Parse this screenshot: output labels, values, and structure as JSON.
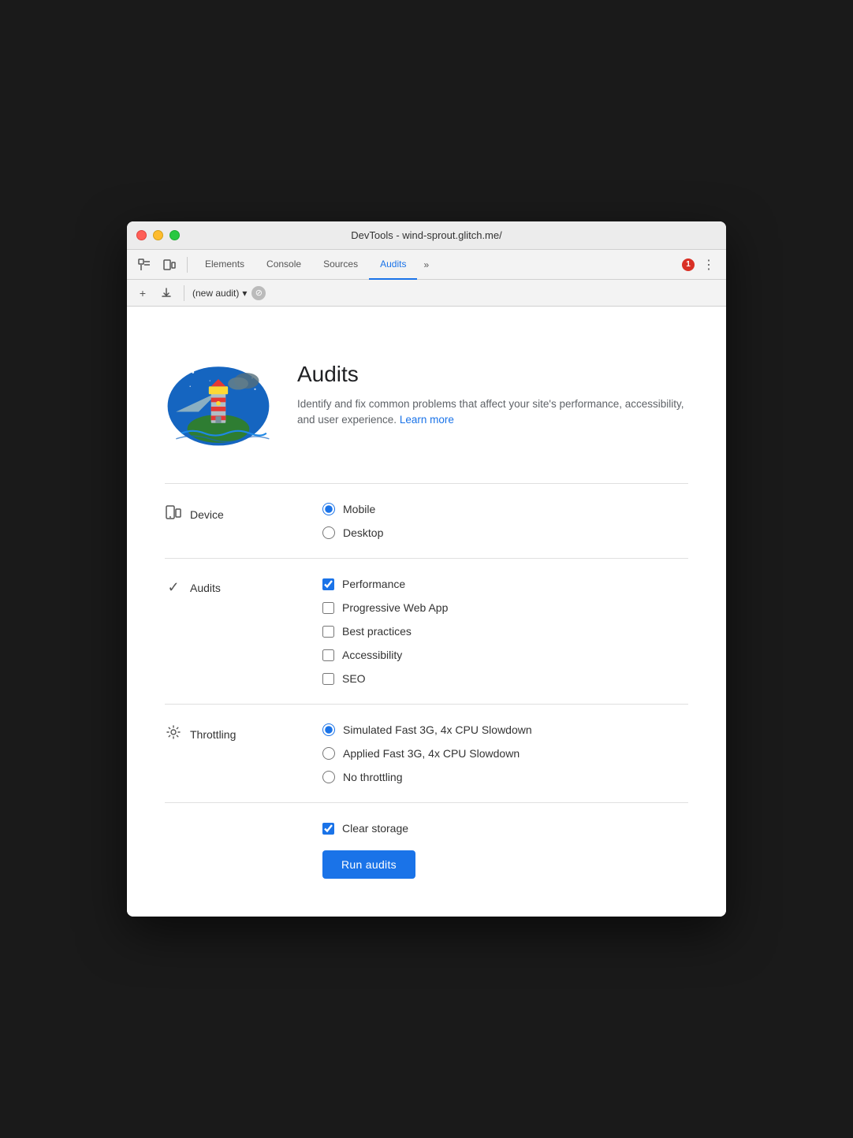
{
  "window": {
    "title": "DevTools - wind-sprout.glitch.me/"
  },
  "tabs": {
    "items": [
      {
        "label": "Elements",
        "active": false
      },
      {
        "label": "Console",
        "active": false
      },
      {
        "label": "Sources",
        "active": false
      },
      {
        "label": "Audits",
        "active": true
      }
    ],
    "overflow_label": "»",
    "error_count": "1"
  },
  "secondary_toolbar": {
    "new_label": "+",
    "download_label": "⬇",
    "audit_name": "(new audit)",
    "dropdown_icon": "▾",
    "cancel_icon": "⊘"
  },
  "hero": {
    "title": "Audits",
    "description": "Identify and fix common problems that affect your site's performance, accessibility, and user experience.",
    "learn_more": "Learn more"
  },
  "device": {
    "label": "Device",
    "options": [
      {
        "label": "Mobile",
        "checked": true
      },
      {
        "label": "Desktop",
        "checked": false
      }
    ]
  },
  "audits": {
    "label": "Audits",
    "options": [
      {
        "label": "Performance",
        "checked": true
      },
      {
        "label": "Progressive Web App",
        "checked": false
      },
      {
        "label": "Best practices",
        "checked": false
      },
      {
        "label": "Accessibility",
        "checked": false
      },
      {
        "label": "SEO",
        "checked": false
      }
    ]
  },
  "throttling": {
    "label": "Throttling",
    "options": [
      {
        "label": "Simulated Fast 3G, 4x CPU Slowdown",
        "checked": true
      },
      {
        "label": "Applied Fast 3G, 4x CPU Slowdown",
        "checked": false
      },
      {
        "label": "No throttling",
        "checked": false
      }
    ]
  },
  "clear_storage": {
    "label": "Clear storage",
    "checked": true
  },
  "run_button": {
    "label": "Run audits"
  }
}
